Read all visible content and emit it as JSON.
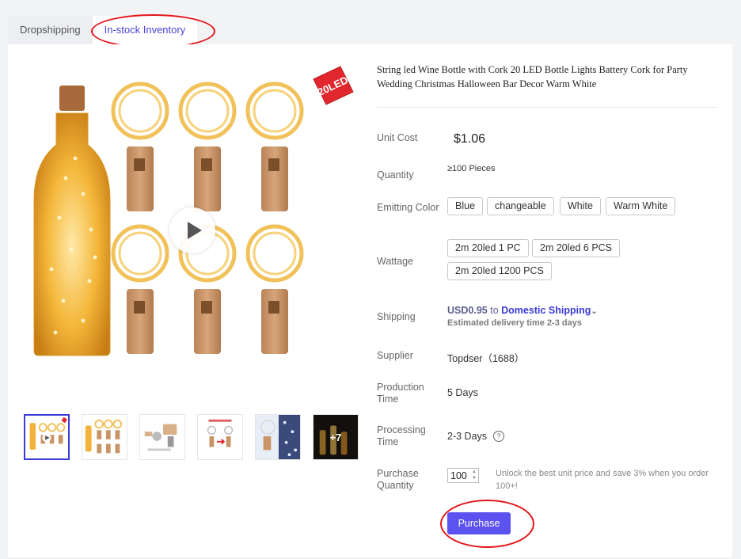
{
  "tabs": [
    {
      "label": "Dropshipping",
      "active": false
    },
    {
      "label": "In-stock Inventory",
      "active": true
    }
  ],
  "gallery": {
    "badge_text": "20LED",
    "play_icon": "play-icon",
    "thumbnails": [
      "bottle-and-lights",
      "six-cork-lights",
      "battery-cork-detail",
      "instructions",
      "bottles-in-use",
      "lit-bottles"
    ],
    "more_count": "+7"
  },
  "product": {
    "title": "String led Wine Bottle with Cork 20 LED Bottle Lights Battery Cork for Party Wedding Christmas Halloween Bar Decor Warm White"
  },
  "fields": {
    "unit_cost_label": "Unit Cost",
    "unit_cost_value": "$1.06",
    "quantity_label": "Quantity",
    "quantity_value": "≥100 Pieces",
    "emitting_color_label": "Emitting Color",
    "emitting_colors": [
      "Blue",
      "changeable",
      "White",
      "Warm White"
    ],
    "wattage_label": "Wattage",
    "wattages": [
      "2m 20led 1 PC",
      "2m 20led 6 PCS",
      "2m 20led 1200 PCS"
    ],
    "shipping_label": "Shipping",
    "shipping_price": "USD0.95",
    "shipping_to": "to",
    "shipping_method": "Domestic Shipping",
    "shipping_estimate": "Estimated delivery time 2-3 days",
    "supplier_label": "Supplier",
    "supplier_value": "Topdser（1688）",
    "production_time_label": "Production Time",
    "production_time_value": "5 Days",
    "processing_time_label": "Processing Time",
    "processing_time_value": "2-3 Days",
    "purchase_quantity_label": "Purchase Quantity",
    "purchase_quantity_value": "100",
    "unlock_note": "Unlock the best unit price and save 3% when you order 100+!"
  },
  "actions": {
    "purchase_label": "Purchase"
  },
  "colors": {
    "accent": "#5b52f0",
    "tab_active_text": "#4b43d8",
    "link": "#3b3bd6",
    "annotation": "#e3151a",
    "badge": "#e0272e"
  }
}
